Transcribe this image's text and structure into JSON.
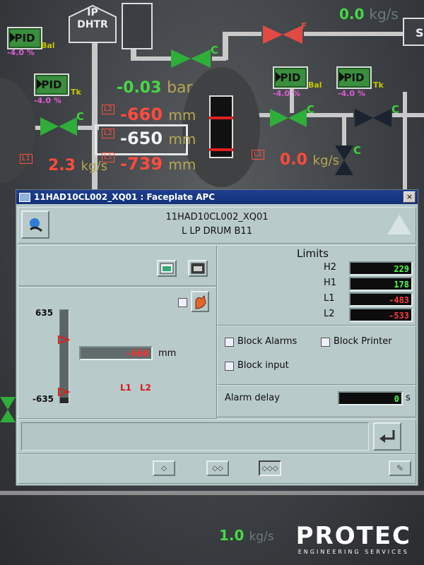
{
  "process": {
    "ip_dhtr": "IP\nDHTR",
    "ip": "IP",
    "dhtr": "DHTR",
    "pid_label": "PID",
    "pid_items": [
      {
        "pct": "-4.0 %",
        "tag": "Bal"
      },
      {
        "pct": "-4.0 %",
        "tag": "Tk"
      },
      {
        "pct": "-4.0 %",
        "tag": "Bal"
      },
      {
        "pct": "-4.0 %",
        "tag": "Tk"
      }
    ],
    "valve_tag": "C",
    "flow_top_right": "0.0",
    "flow_unit": "kg/s",
    "pressure_value": "-0.03",
    "pressure_unit": "bar",
    "level_l2_top": "-660",
    "level_selected": "-650",
    "level_bottom": "-739",
    "level_unit": "mm",
    "flow_left": "2.3",
    "flow_mid": "0.0",
    "flow_bottom": "1.0",
    "l1": "L1",
    "l2": "L2",
    "h_tag": "F"
  },
  "faceplate": {
    "title": "11HAD10CL002_XQ01 : Faceplate APC",
    "close": "×",
    "tag_name": "11HAD10CL002_XQ01",
    "description": "L LP DRUM B11",
    "scale_top": "635",
    "scale_bottom": "-635",
    "value": "-660",
    "unit": "mm",
    "alarm_l1": "L1",
    "alarm_l2": "L2",
    "limits_title": "Limits",
    "limits": [
      {
        "name": "H2",
        "value": "229",
        "color": "#4dff4d"
      },
      {
        "name": "H1",
        "value": "178",
        "color": "#4dff4d"
      },
      {
        "name": "L1",
        "value": "-483",
        "color": "#ff3b3b"
      },
      {
        "name": "L2",
        "value": "-533",
        "color": "#ff3b3b"
      }
    ],
    "block_alarms": "Block Alarms",
    "block_printer": "Block Printer",
    "block_input": "Block input",
    "alarm_delay_label": "Alarm delay",
    "alarm_delay_value": "0",
    "alarm_delay_unit": "s",
    "nav_buttons": [
      "◇",
      "◇◇",
      "◇◇◇"
    ]
  },
  "brand": {
    "name": "PROTEC",
    "sub": "ENGINEERING SERVICES"
  },
  "colors": {
    "titlebar": "#1d3f8e",
    "panel": "#b9caca",
    "alarm_red": "#ff3b3b",
    "ok_green": "#4dff4d"
  }
}
